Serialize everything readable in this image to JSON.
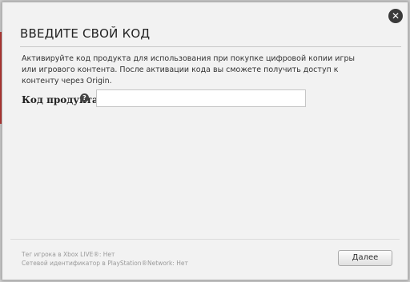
{
  "dialog": {
    "title": "ВВЕДИТЕ СВОЙ КОД",
    "description": "Активируйте код продукта для использования при покупке цифровой копии игры или игрового контента. После активации кода вы сможете получить доступ к контенту через Origin.",
    "close_icon": "close-icon",
    "close_glyph": "✕"
  },
  "form": {
    "code_label": "Код продукта",
    "help_icon": "help-icon",
    "help_glyph": "?",
    "code_value": "",
    "code_placeholder": ""
  },
  "footer": {
    "xbox_gamertag": "Тег игрока в Xbox LIVE®: Нет",
    "psn_id": "Сетевой идентификатор в PlayStation®Network: Нет",
    "next_label": "Далее"
  },
  "colors": {
    "dialog_bg": "#f2f2f2",
    "backdrop_accent": "#b93a36",
    "close_button": "#3a3a3a"
  }
}
